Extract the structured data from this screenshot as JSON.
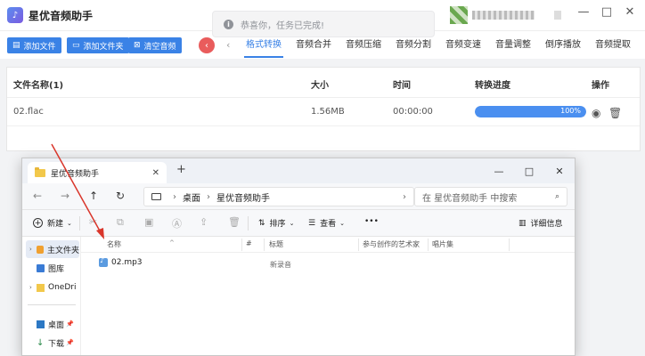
{
  "app": {
    "title": "星优音频助手",
    "logo_text": "♪",
    "window_controls": [
      "—",
      "□",
      "✕"
    ]
  },
  "toast": {
    "icon": "i",
    "message": "恭喜你，任务已完成!"
  },
  "toolbar": {
    "add_file": "添加文件",
    "add_folder": "添加文件夹",
    "clear_audio": "清空音频",
    "collapse_icon": "‹"
  },
  "tabs": [
    {
      "label": "格式转换",
      "active": true
    },
    {
      "label": "音频合并"
    },
    {
      "label": "音频压缩"
    },
    {
      "label": "音频分割"
    },
    {
      "label": "音频变速"
    },
    {
      "label": "音量调整"
    },
    {
      "label": "倒序播放"
    },
    {
      "label": "音频提取"
    }
  ],
  "file_table": {
    "headers": {
      "name": "文件名称(1)",
      "size": "大小",
      "time": "时间",
      "progress": "转换进度",
      "ops": "操作"
    },
    "rows": [
      {
        "name": "02.flac",
        "size": "1.56MB",
        "time": "00:00:00",
        "progress": 1.0,
        "progress_label": "100%"
      }
    ]
  },
  "explorer": {
    "tab_title": "星优音频助手",
    "address": {
      "root": "桌面",
      "folder": "星优音频助手"
    },
    "search_placeholder": "在 星优音频助手 中搜索",
    "commands": {
      "new": "新建",
      "sort": "排序",
      "view": "查看",
      "more": "•••",
      "details": "详细信息"
    },
    "sidebar": [
      {
        "label": "主文件夹",
        "selected": true
      },
      {
        "label": "图库"
      },
      {
        "label": "OneDri"
      },
      {
        "label": "桌面"
      },
      {
        "label": "下载"
      }
    ],
    "columns": {
      "name": "名称",
      "num": "#",
      "title": "标题",
      "artist": "参与创作的艺术家",
      "album": "唱片集"
    },
    "files": [
      {
        "name": "02.mp3",
        "title": "新录音"
      }
    ]
  },
  "colors": {
    "accent": "#3a82e6",
    "collapse": "#e95c5c",
    "progress": "#4a8ff0",
    "arrow": "#d9362b"
  }
}
